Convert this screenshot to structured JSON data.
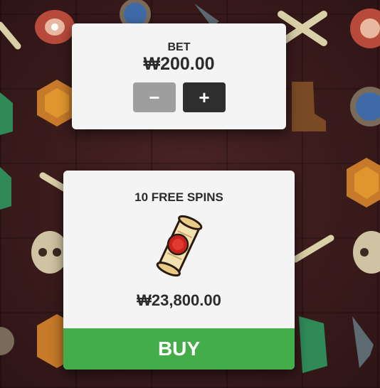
{
  "bet": {
    "label": "BET",
    "value": "₩200.00",
    "minus_label": "−",
    "plus_label": "+"
  },
  "buy_feature": {
    "title": "10 FREE SPINS",
    "icon": "scroll-icon",
    "price": "₩23,800.00",
    "buy_label": "BUY"
  },
  "colors": {
    "panel": "#f4f4f4",
    "buy_green": "#43ad49",
    "minus_grey": "#9e9e9e",
    "plus_dark": "#2e2e2e",
    "background": "#3a1a1b"
  }
}
